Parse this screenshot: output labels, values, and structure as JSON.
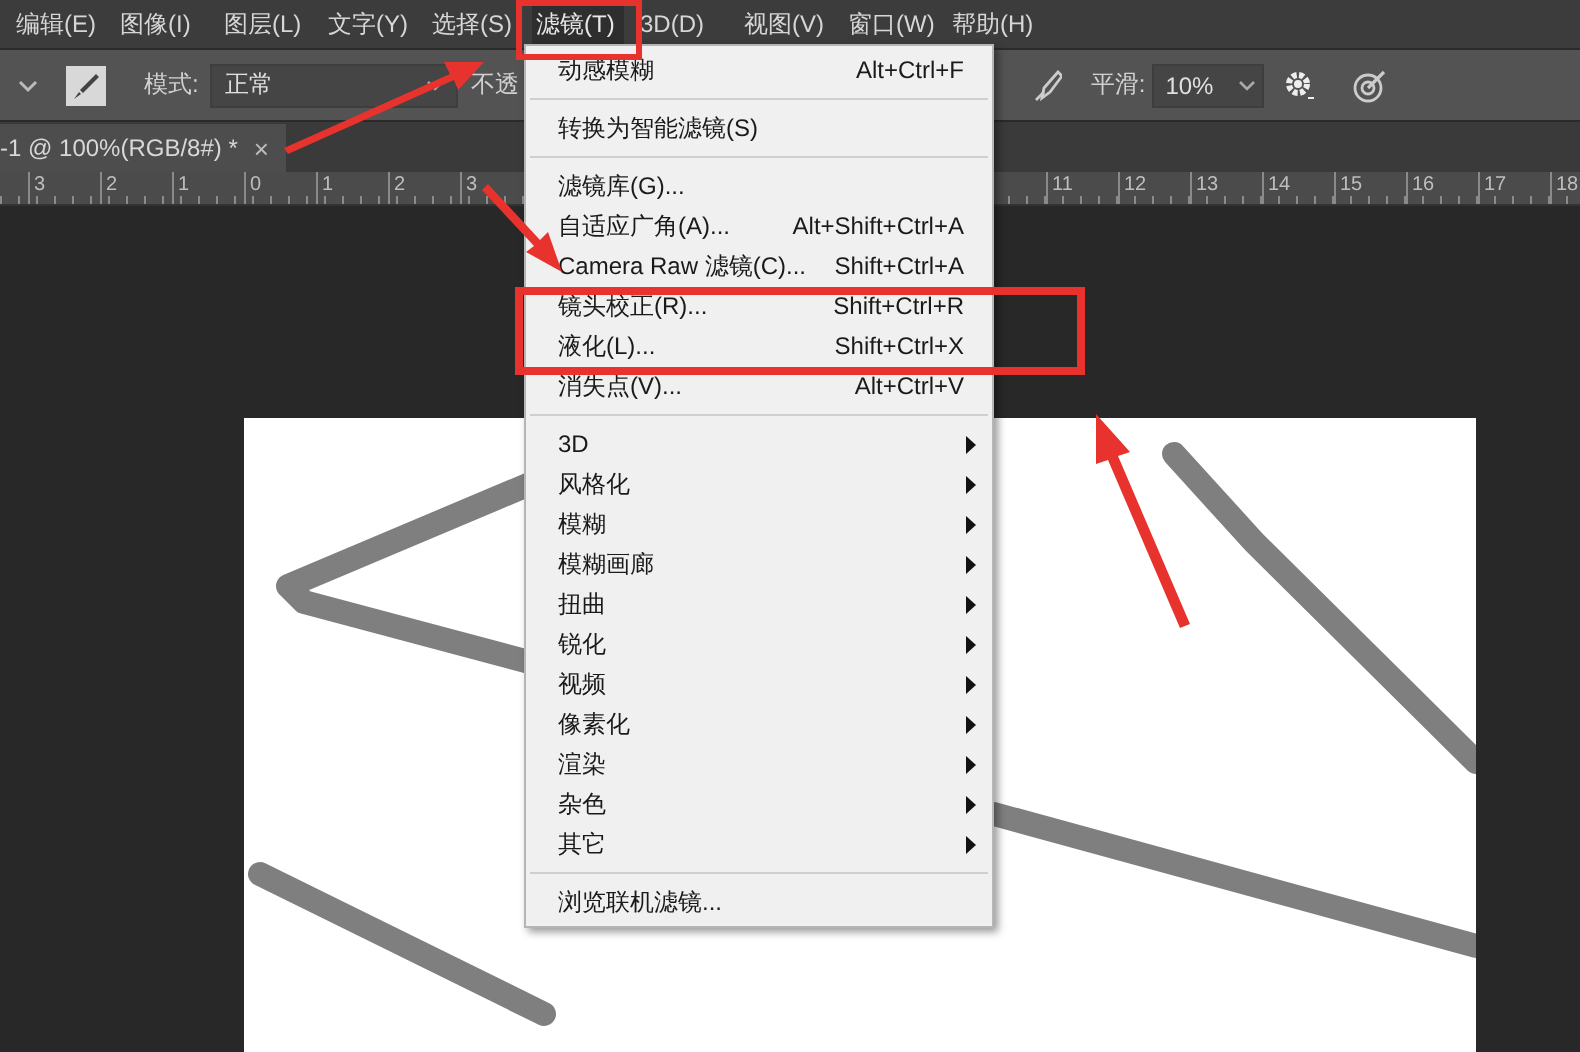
{
  "menu_bar": [
    {
      "label": "编辑(E)",
      "selected": false
    },
    {
      "label": "图像(I)",
      "selected": false
    },
    {
      "label": "图层(L)",
      "selected": false
    },
    {
      "label": "文字(Y)",
      "selected": false
    },
    {
      "label": "选择(S)",
      "selected": false
    },
    {
      "label": "滤镜(T)",
      "selected": true
    },
    {
      "label": "3D(D)",
      "selected": false
    },
    {
      "label": "视图(V)",
      "selected": false
    },
    {
      "label": "窗口(W)",
      "selected": false
    },
    {
      "label": "帮助(H)",
      "selected": false
    }
  ],
  "options_bar": {
    "mode_label": "模式:",
    "mode_value": "正常",
    "opacity_label": "不透",
    "smoothing_label": "平滑:",
    "smoothing_value": "10%"
  },
  "document_tab": {
    "title": "-1 @ 100%(RGB/8#) *",
    "close": "×"
  },
  "ruler": {
    "left_labels": [
      "3",
      "2",
      "1",
      "0",
      "1",
      "2",
      "3"
    ],
    "right_labels": [
      "11",
      "12",
      "13",
      "14",
      "15",
      "16",
      "17",
      "18"
    ]
  },
  "filter_menu": {
    "items": [
      {
        "kind": "item",
        "label": "动感模糊",
        "shortcut": "Alt+Ctrl+F"
      },
      {
        "kind": "separator"
      },
      {
        "kind": "item",
        "label": "转换为智能滤镜(S)"
      },
      {
        "kind": "separator"
      },
      {
        "kind": "item",
        "label": "滤镜库(G)..."
      },
      {
        "kind": "item",
        "label": "自适应广角(A)...",
        "shortcut": "Alt+Shift+Ctrl+A"
      },
      {
        "kind": "item",
        "label": "Camera Raw 滤镜(C)...",
        "shortcut": "Shift+Ctrl+A"
      },
      {
        "kind": "item",
        "label": "镜头校正(R)...",
        "shortcut": "Shift+Ctrl+R"
      },
      {
        "kind": "item",
        "label": "液化(L)...",
        "shortcut": "Shift+Ctrl+X"
      },
      {
        "kind": "item",
        "label": "消失点(V)...",
        "shortcut": "Alt+Ctrl+V"
      },
      {
        "kind": "separator"
      },
      {
        "kind": "submenu",
        "label": "3D"
      },
      {
        "kind": "submenu",
        "label": "风格化"
      },
      {
        "kind": "submenu",
        "label": "模糊"
      },
      {
        "kind": "submenu",
        "label": "模糊画廊"
      },
      {
        "kind": "submenu",
        "label": "扭曲"
      },
      {
        "kind": "submenu",
        "label": "锐化"
      },
      {
        "kind": "submenu",
        "label": "视频"
      },
      {
        "kind": "submenu",
        "label": "像素化"
      },
      {
        "kind": "submenu",
        "label": "渲染"
      },
      {
        "kind": "submenu",
        "label": "杂色"
      },
      {
        "kind": "submenu",
        "label": "其它"
      },
      {
        "kind": "separator"
      },
      {
        "kind": "item",
        "label": "浏览联机滤镜..."
      }
    ]
  }
}
